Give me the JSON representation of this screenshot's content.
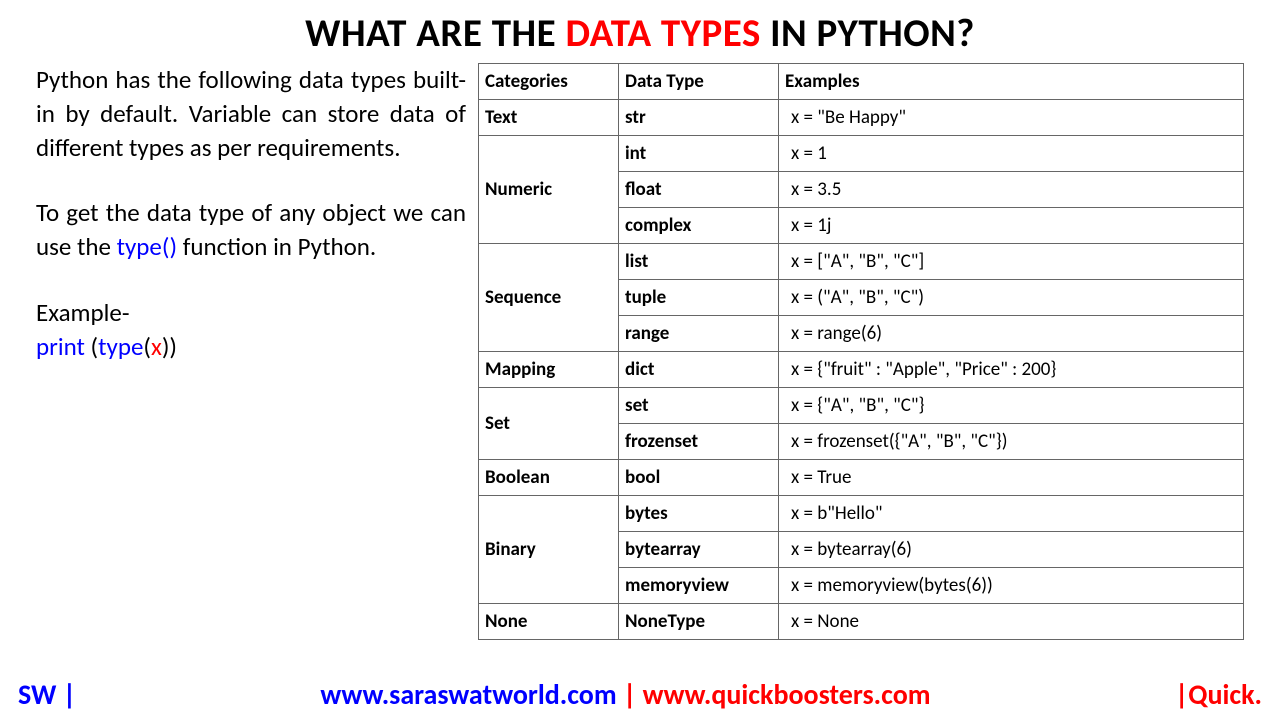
{
  "title": {
    "part1": "WHAT ARE THE ",
    "highlight": "DATA TYPES",
    "part2": " IN PYTHON?"
  },
  "left": {
    "para1": "Python has the following data types built-in by default. Variable can store data of different types as per requirements.",
    "para2_a": "To get the data type of any object we can use the ",
    "para2_b": "type()",
    "para2_c": " function in Python.",
    "example_label": "Example-",
    "ex_print": "print ",
    "ex_paren1": "(",
    "ex_type": "type",
    "ex_paren2": "(",
    "ex_x": "x",
    "ex_close": "))"
  },
  "table": {
    "headers": [
      "Categories",
      "Data Type",
      "Examples"
    ],
    "rows": [
      {
        "cat": "Text",
        "span": 1,
        "types": [
          {
            "dt": "str",
            "ex": "x = \"Be Happy\""
          }
        ]
      },
      {
        "cat": "Numeric",
        "span": 3,
        "types": [
          {
            "dt": "int",
            "ex": "x = 1"
          },
          {
            "dt": "float",
            "ex": "x = 3.5"
          },
          {
            "dt": "complex",
            "ex": "x = 1j"
          }
        ]
      },
      {
        "cat": "Sequence",
        "span": 3,
        "types": [
          {
            "dt": "list",
            "ex": "x = [\"A\", \"B\", \"C\"]"
          },
          {
            "dt": "tuple",
            "ex": "x = (\"A\", \"B\", \"C\")"
          },
          {
            "dt": "range",
            "ex": "x = range(6)"
          }
        ]
      },
      {
        "cat": "Mapping",
        "span": 1,
        "types": [
          {
            "dt": "dict",
            "ex": "x = {\"fruit\" : \"Apple\", \"Price\" : 200}"
          }
        ]
      },
      {
        "cat": "Set",
        "span": 2,
        "types": [
          {
            "dt": "set",
            "ex": "x = {\"A\", \"B\", \"C\"}"
          },
          {
            "dt": "frozenset",
            "ex": "x = frozenset({\"A\",  \"B\", \"C\"})"
          }
        ]
      },
      {
        "cat": "Boolean",
        "span": 1,
        "types": [
          {
            "dt": "bool",
            "ex": "x = True"
          }
        ]
      },
      {
        "cat": "Binary",
        "span": 3,
        "types": [
          {
            "dt": "bytes",
            "ex": "x = b\"Hello\""
          },
          {
            "dt": "bytearray",
            "ex": "x = bytearray(6)"
          },
          {
            "dt": "memoryview",
            "ex": "x = memoryview(bytes(6))"
          }
        ]
      },
      {
        "cat": "None",
        "span": 1,
        "types": [
          {
            "dt": "NoneType",
            "ex": "x = None"
          }
        ]
      }
    ]
  },
  "footer": {
    "sw": "SW |",
    "url1": "www.saraswatworld.com",
    "sep": " | ",
    "url2": "www.quickboosters.com",
    "quick": "|Quick."
  }
}
